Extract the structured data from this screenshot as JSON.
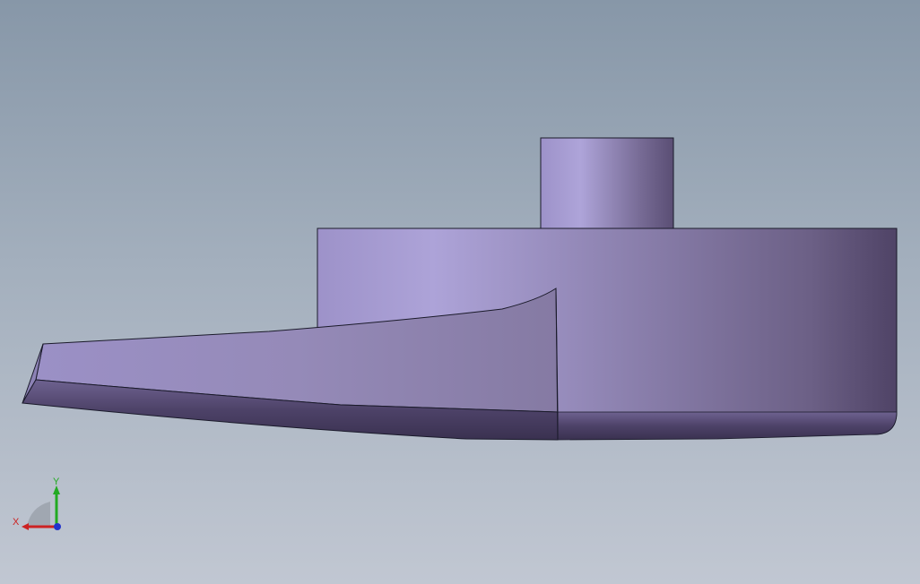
{
  "triad": {
    "x_label": "X",
    "y_label": "Y",
    "x_color": "#cc2222",
    "y_color": "#22aa22",
    "z_color": "#2233cc"
  },
  "model": {
    "face_light": "#a99fd4",
    "face_mid": "#8a7fb0",
    "face_dark": "#564a72",
    "edge_color": "#1a1a2a"
  },
  "icons": {
    "triad": "xyz-triad-icon"
  }
}
